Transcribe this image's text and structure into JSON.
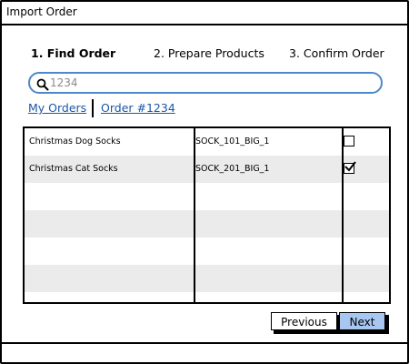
{
  "window": {
    "title": "Import Order"
  },
  "steps": [
    {
      "label": "1. Find Order",
      "active": true
    },
    {
      "label": "2. Prepare Products",
      "active": false
    },
    {
      "label": "3. Confirm Order",
      "active": false
    }
  ],
  "search": {
    "value": "",
    "placeholder": "1234",
    "icon": "search-icon"
  },
  "breadcrumb": [
    {
      "label": "My Orders"
    },
    {
      "label": "Order #1234"
    }
  ],
  "table": {
    "rows": [
      {
        "name": "Christmas Dog Socks",
        "sku": "SOCK_101_BIG_1",
        "checked": false
      },
      {
        "name": "Christmas Cat Socks",
        "sku": "SOCK_201_BIG_1",
        "checked": true
      }
    ],
    "empty_rows": 4
  },
  "pager": {
    "previous_label": "Previous",
    "next_label": "Next"
  },
  "colors": {
    "accent": "#4e88c9",
    "link": "#1b57a8",
    "primary_button": "#a8c7f0",
    "row_alt": "#ebebeb"
  }
}
